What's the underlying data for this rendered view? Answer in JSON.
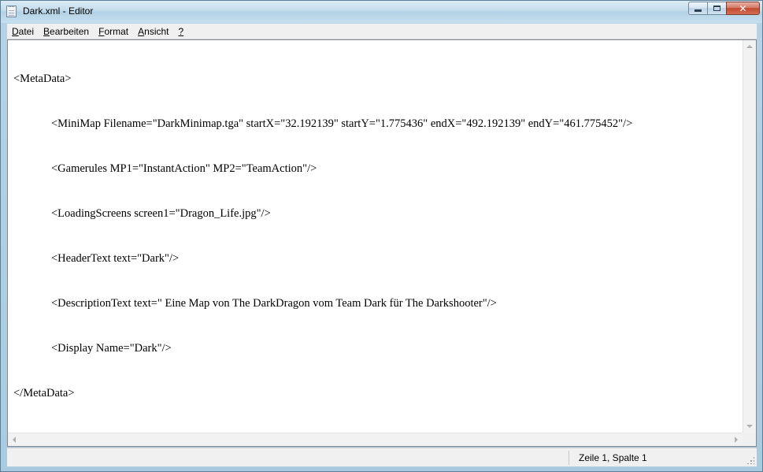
{
  "window": {
    "title": "Dark.xml - Editor",
    "caption_buttons": {
      "minimize": "minimize-icon",
      "maximize": "maximize-icon",
      "close": "✕"
    }
  },
  "menu": {
    "items": [
      {
        "label": "Datei",
        "accel": "D",
        "rest": "atei"
      },
      {
        "label": "Bearbeiten",
        "accel": "B",
        "rest": "earbeiten"
      },
      {
        "label": "Format",
        "accel": "F",
        "rest": "ormat"
      },
      {
        "label": "Ansicht",
        "accel": "A",
        "rest": "nsicht"
      },
      {
        "label": "?",
        "accel": "?",
        "rest": ""
      }
    ]
  },
  "document": {
    "lines": [
      "<MetaData>",
      "<MiniMap Filename=\"DarkMinimap.tga\" startX=\"32.192139\" startY=\"1.775436\" endX=\"492.192139\" endY=\"461.775452\"/>",
      "<Gamerules MP1=\"InstantAction\" MP2=\"TeamAction\"/>",
      "<LoadingScreens screen1=\"Dragon_Life.jpg\"/>",
      "<HeaderText text=\"Dark\"/>",
      "<DescriptionText text=\" Eine Map von The DarkDragon vom Team Dark für The Darkshooter\"/>",
      "<Display Name=\"Dark\"/>",
      "</MetaData>"
    ]
  },
  "statusbar": {
    "position": "Zeile 1, Spalte 1"
  },
  "colors": {
    "titlebar": "#c3dcec",
    "close_button": "#c24a30",
    "editor_bg": "#ffffff",
    "chrome_bg": "#f0f0f0"
  }
}
